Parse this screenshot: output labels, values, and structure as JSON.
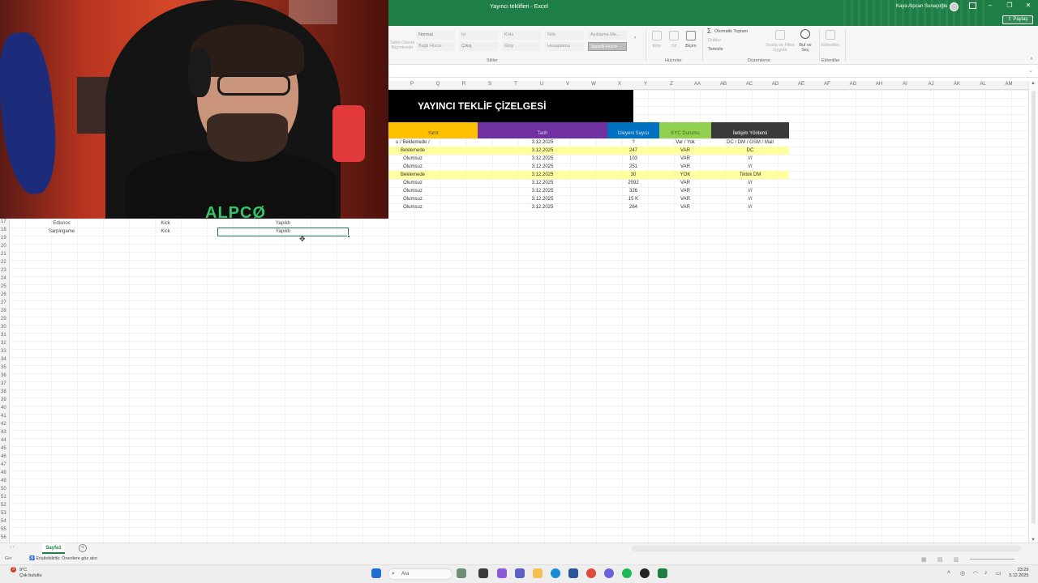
{
  "window": {
    "title": "Yayıncı teklifleri  -  Excel",
    "user": "Kaya Alpcan Sunaçoğlu",
    "share_label": "Paylaş",
    "controls": [
      "–",
      "❐",
      "✕"
    ]
  },
  "ribbon": {
    "styles": {
      "row1": [
        "Normal",
        "İyi",
        "Kötü",
        "Nötr",
        "Açıklama Me..."
      ],
      "row2": [
        "Bağlı Hücre",
        "Çıkış",
        "Giriş",
        "Hesaplama",
        "İşaretli Hücre"
      ],
      "group_label": "Stiller",
      "left_faint": "Tablo Olarak Biçimlendir"
    },
    "cells": {
      "items": [
        "Ekle",
        "Sil",
        "Biçim"
      ],
      "group_label": "Hücreler"
    },
    "editing": {
      "autosum": "Otomatik Toplam",
      "fill": "Doldur",
      "clear": "Temizle",
      "sort_filter": "Sırala ve Filtre Uygula",
      "find_select": "Bul ve Seç",
      "group_label": "Düzenleme"
    },
    "addins": {
      "label": "Eklentiler",
      "group_label": "Eklentiler"
    }
  },
  "columns": [
    "P",
    "Q",
    "R",
    "S",
    "T",
    "U",
    "V",
    "W",
    "X",
    "Y",
    "Z",
    "AA",
    "AB",
    "AC",
    "AD",
    "AE",
    "AF",
    "AG",
    "AH",
    "AI",
    "AJ",
    "AK",
    "AL",
    "AM"
  ],
  "rows": [
    "17",
    "18",
    "19",
    "20",
    "21",
    "22",
    "23",
    "24",
    "25",
    "26",
    "27",
    "28",
    "29",
    "30",
    "31",
    "32",
    "33",
    "34",
    "35",
    "36",
    "37",
    "38",
    "39",
    "40",
    "41",
    "42",
    "43",
    "44",
    "45",
    "46",
    "47",
    "48",
    "49",
    "50",
    "51",
    "52",
    "53",
    "54",
    "55",
    "56"
  ],
  "sheet": {
    "title": "YAYINCI TEKLİF ÇİZELGESİ",
    "headers": [
      {
        "label": "Yanıt",
        "color": "#ffc000",
        "text_color": "#555555"
      },
      {
        "label": "Tarih",
        "color": "#7030a0",
        "text_color": "#d9c9e8"
      },
      {
        "label": "İzleyeni Sayısı",
        "color": "#0070c0",
        "text_color": "#cfe3f5"
      },
      {
        "label": "KYC Durumu",
        "color": "#92d050",
        "text_color": "#3e6b1a"
      },
      {
        "label": "İletişim Yöntemi",
        "color": "#3a3a3a",
        "text_color": "#ffffff"
      }
    ],
    "data_rows": [
      {
        "yanit": "u / Beklemede / Olumsuz",
        "tarih": "3.12.2025",
        "izleyici": "?",
        "kyc": "Var / Yok",
        "iletisim": "DC / DM / GSM / Mail",
        "highlight": false
      },
      {
        "yanit": "Beklemede",
        "tarih": "3.12.2025",
        "izleyici": "247",
        "kyc": "VAR",
        "iletisim": "DC",
        "highlight": true
      },
      {
        "yanit": "Olumsuz",
        "tarih": "3.12.2025",
        "izleyici": "103",
        "kyc": "VAR",
        "iletisim": "///",
        "highlight": false
      },
      {
        "yanit": "Olumsuz",
        "tarih": "3.12.2025",
        "izleyici": "251",
        "kyc": "VAR",
        "iletisim": "///",
        "highlight": false
      },
      {
        "yanit": "Beklemede",
        "tarih": "3.12.2025",
        "izleyici": "30",
        "kyc": "YOK",
        "iletisim": "Tiktok DM",
        "highlight": true
      },
      {
        "yanit": "Olumsuz",
        "tarih": "3.12.2025",
        "izleyici": "2092",
        "kyc": "VAR",
        "iletisim": "///",
        "highlight": false
      },
      {
        "yanit": "Olumsuz",
        "tarih": "3.12.2025",
        "izleyici": "326",
        "kyc": "VAR",
        "iletisim": "///",
        "highlight": false
      },
      {
        "yanit": "Olumsuz",
        "tarih": "3.12.2025",
        "izleyici": "15 K",
        "kyc": "VAR",
        "iletisim": "///",
        "highlight": false
      },
      {
        "yanit": "Olumsuz",
        "tarih": "3.12.2025",
        "izleyici": "264",
        "kyc": "VAR",
        "iletisim": "///",
        "highlight": false
      }
    ],
    "left_rows": [
      {
        "name": "Edisnos",
        "platform": "Kick",
        "status": "Yapıldı"
      },
      {
        "name": "Sarpingame",
        "platform": "Kick",
        "status": "Yapıldı"
      }
    ]
  },
  "webcam": {
    "shirt_text": "ALPCØ"
  },
  "tabs": {
    "sheet_name": "Sayfa1",
    "add_label": "+"
  },
  "status": {
    "ready": "Giri",
    "accessibility": "Erişilebilirlik: Önerilere göz atın"
  },
  "taskbar": {
    "weather_temp": "9°C",
    "weather_desc": "Çok bulutlu",
    "weather_badge": "3",
    "search_placeholder": "Ara",
    "time": "23:29",
    "date": "3.12.2025"
  }
}
